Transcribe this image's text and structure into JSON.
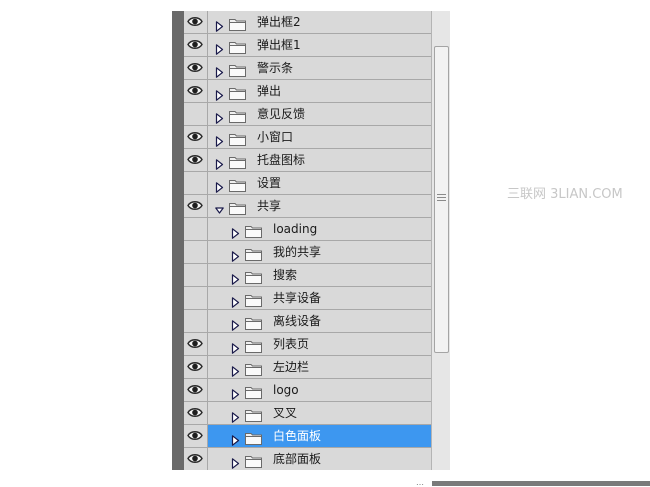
{
  "layers": [
    {
      "name": "弹出框2",
      "visible": true,
      "level": 0,
      "expanded": false,
      "selected": false
    },
    {
      "name": "弹出框1",
      "visible": true,
      "level": 0,
      "expanded": false,
      "selected": false
    },
    {
      "name": "警示条",
      "visible": true,
      "level": 0,
      "expanded": false,
      "selected": false
    },
    {
      "name": "弹出",
      "visible": true,
      "level": 0,
      "expanded": false,
      "selected": false
    },
    {
      "name": "意见反馈",
      "visible": false,
      "level": 0,
      "expanded": false,
      "selected": false
    },
    {
      "name": "小窗口",
      "visible": true,
      "level": 0,
      "expanded": false,
      "selected": false
    },
    {
      "name": "托盘图标",
      "visible": true,
      "level": 0,
      "expanded": false,
      "selected": false
    },
    {
      "name": "设置",
      "visible": false,
      "level": 0,
      "expanded": false,
      "selected": false
    },
    {
      "name": "共享",
      "visible": true,
      "level": 0,
      "expanded": true,
      "selected": false
    },
    {
      "name": "loading",
      "visible": false,
      "level": 1,
      "expanded": false,
      "selected": false
    },
    {
      "name": "我的共享",
      "visible": false,
      "level": 1,
      "expanded": false,
      "selected": false
    },
    {
      "name": "搜索",
      "visible": false,
      "level": 1,
      "expanded": false,
      "selected": false
    },
    {
      "name": "共享设备",
      "visible": false,
      "level": 1,
      "expanded": false,
      "selected": false
    },
    {
      "name": "离线设备",
      "visible": false,
      "level": 1,
      "expanded": false,
      "selected": false
    },
    {
      "name": "列表页",
      "visible": true,
      "level": 1,
      "expanded": false,
      "selected": false
    },
    {
      "name": "左边栏",
      "visible": true,
      "level": 1,
      "expanded": false,
      "selected": false
    },
    {
      "name": "logo",
      "visible": true,
      "level": 1,
      "expanded": false,
      "selected": false
    },
    {
      "name": "叉叉",
      "visible": true,
      "level": 1,
      "expanded": false,
      "selected": false
    },
    {
      "name": "白色面板",
      "visible": true,
      "level": 1,
      "expanded": false,
      "selected": true
    },
    {
      "name": "底部面板",
      "visible": true,
      "level": 1,
      "expanded": false,
      "selected": false
    }
  ],
  "watermark": "三联网 3LIAN.COM",
  "colors": {
    "selection": "#3d97f0",
    "panel": "#d9d9d9",
    "divider": "#a8a8a8"
  }
}
